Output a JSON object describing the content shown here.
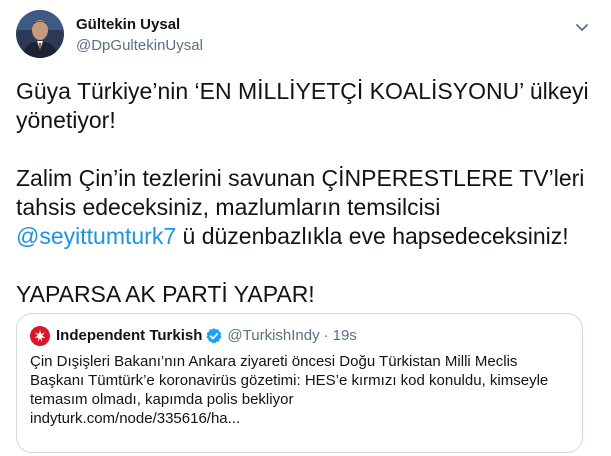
{
  "author": {
    "display_name": "Gültekin Uysal",
    "handle": "@DpGultekinUysal"
  },
  "tweet": {
    "para1": "Güya Türkiye’nin ‘EN MİLLİYETÇİ KOALİSYONU’ ülkeyi yönetiyor!",
    "para2_a": "Zalim Çin’in tezlerini savunan ÇİNPERESTLERE TV’leri tahsis edeceksiniz, mazlumların temsilcisi ",
    "mention": "@seyittumturk7",
    "para2_b": " ü düzenbazlıkla eve hapsedeceksiniz!",
    "para3": "YAPARSA AK PARTİ YAPAR!"
  },
  "quote": {
    "name": "Independent Turkish",
    "handle": "@TurkishIndy",
    "dot": "·",
    "time": "19s",
    "text": "Çin Dışişleri Bakanı’nın Ankara ziyareti öncesi Doğu Türkistan Milli Meclis Başkanı Tümtürk’e koronavirüs gözetimi: HES’e kırmızı kod konuldu, kimseyle temasım olmadı, kapımda polis bekliyor",
    "link": "indyturk.com/node/335616/ha..."
  },
  "icons": {
    "more": "chevron-down-icon",
    "verified": "verified-badge-icon",
    "logo": "independent-logo-icon"
  },
  "colors": {
    "link": "#1b95e0",
    "secondary": "#5b7083",
    "verified": "#1da1f2",
    "logo_red": "#d7182a"
  }
}
